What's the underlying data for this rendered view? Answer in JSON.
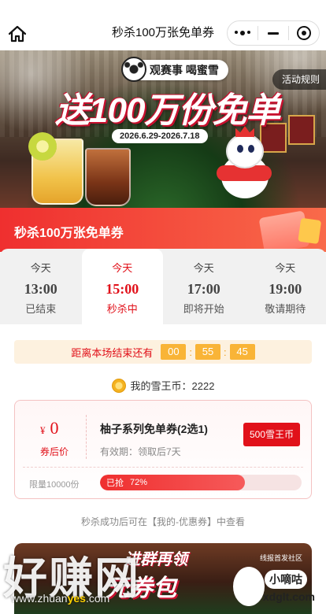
{
  "nav": {
    "title": "秒杀100万张免单券",
    "home_icon": "home-icon",
    "menu_icon": "more-dots-icon",
    "minimize_icon": "minimize-icon",
    "close_icon": "target-close-icon"
  },
  "banner": {
    "tag": "观赛事 喝蜜雪",
    "headline": "送100万份免单",
    "date_range": "2026.6.29-2026.7.18",
    "rules_label": "活动规则"
  },
  "section": {
    "title": "秒杀100万张免单券"
  },
  "sessions": [
    {
      "day": "今天",
      "time": "13:00",
      "status": "已结束",
      "active": false
    },
    {
      "day": "今天",
      "time": "15:00",
      "status": "秒杀中",
      "active": true
    },
    {
      "day": "今天",
      "time": "17:00",
      "status": "即将开始",
      "active": false
    },
    {
      "day": "今天",
      "time": "19:00",
      "status": "敬请期待",
      "active": false
    }
  ],
  "countdown": {
    "label": "距离本场结束还有",
    "hours": "00",
    "minutes": "55",
    "seconds": "45"
  },
  "coins": {
    "label": "我的雪王币：2222"
  },
  "coupon": {
    "currency": "¥",
    "price": "0",
    "price_caption": "券后价",
    "name": "柚子系列免单券(2选1)",
    "validity": "有效期：领取后7天",
    "buy_label": "500雪王币",
    "limit": "限量10000份",
    "sold_label": "已抢",
    "sold_percent_label": "72%",
    "sold_fraction": 0.72
  },
  "hint": "秒杀成功后可在【我的-优惠券】中查看",
  "bottom_banner": {
    "line1": "进群再领",
    "line2": "元券包",
    "tag": "线报首发社区",
    "badge": "小嘀咕"
  },
  "watermark": {
    "cn": "好赚网",
    "url_prefix": "www.zhuan",
    "url_highlight": "yes",
    "url_suffix": ".com",
    "site": "xdglt.com"
  },
  "colors": {
    "accent": "#e1111a",
    "countdown_box": "#f9b437",
    "header_gradient_start": "#ef2f2f",
    "header_gradient_end": "#f96a4a"
  }
}
